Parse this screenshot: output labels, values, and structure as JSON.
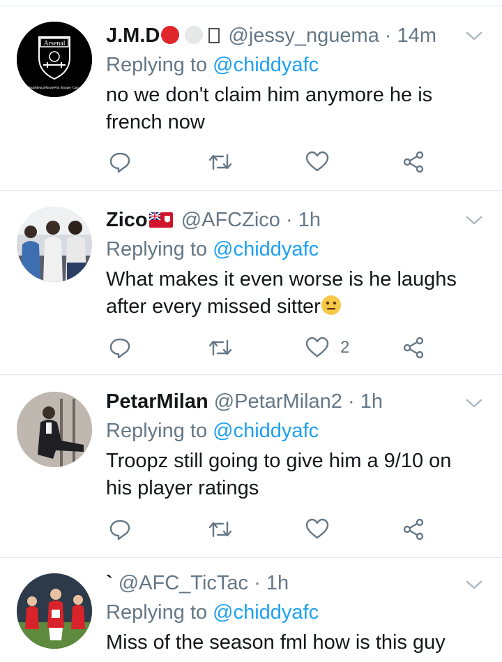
{
  "tweets": [
    {
      "name": "J.M.D",
      "name_suffix": "🔴⚪  ",
      "handle": "@jessy_nguema",
      "time": "14m",
      "replying_prefix": "Replying to",
      "replying_to": "@chiddyafc",
      "text": "no we don't claim him anymore he is french now",
      "likes": "",
      "avatar_label": "Arsenal",
      "avatar_caption": "#StopMentalAbuseWin Stopper Cancer"
    },
    {
      "name": "Zico",
      "name_suffix": "",
      "handle": "@AFCZico",
      "time": "1h",
      "replying_prefix": "Replying to",
      "replying_to": "@chiddyafc",
      "text": "What makes it even worse is he laughs after every missed sitter",
      "likes": "2"
    },
    {
      "name": "PetarMilan",
      "name_suffix": "",
      "handle": "@PetarMilan2",
      "time": "1h",
      "replying_prefix": "Replying to",
      "replying_to": "@chiddyafc",
      "text": "Troopz still going to give him a 9/10 on his player ratings",
      "likes": ""
    },
    {
      "name": "`",
      "name_suffix": "",
      "handle": "@AFC_TicTac",
      "time": "1h",
      "replying_prefix": "Replying to",
      "replying_to": "@chiddyafc",
      "text": "Miss of the season fml how is this guy",
      "likes": ""
    }
  ],
  "icons": {
    "reply": "reply-icon",
    "retweet": "retweet-icon",
    "like": "heart-icon",
    "share": "share-icon",
    "caret": "chevron-down-icon"
  },
  "colors": {
    "link": "#1da1f2",
    "muted": "#657786",
    "text": "#14171a",
    "divider": "#e1e8ed"
  }
}
